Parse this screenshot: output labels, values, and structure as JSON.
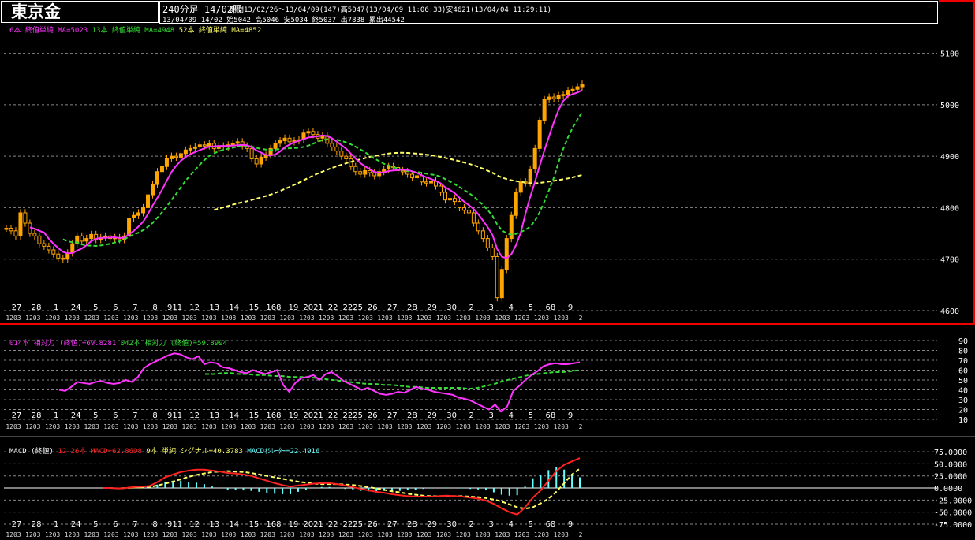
{
  "header": {
    "title": "東京金",
    "line1_main": "240分足 14/02限",
    "line1_rest": "期間13/02/26～13/04/09(147)高5047(13/04/09 11:06:33)安4621(13/04/04 11:29:11)",
    "line2": "13/04/09 14/02 始5042 高5046 安5034 終5037 出7838 累出44542"
  },
  "colors": {
    "magenta": "#ff33ff",
    "green": "#33dd33",
    "yellow": "#ffff66",
    "candle": "#ffa500",
    "cyan": "#66ffff",
    "red": "#ff2222",
    "grid": "#888888"
  },
  "legends": {
    "price": [
      {
        "text": "6本 終値単純 MA=5023",
        "color": "#ff33ff"
      },
      {
        "text": "13本 終値単純 MA=4948",
        "color": "#33dd33"
      },
      {
        "text": "52本 終値単純 MA=4852",
        "color": "#ffff66"
      }
    ],
    "rsi": [
      {
        "text": "014本 相対力 (終値)=69.8281",
        "color": "#ff33ff"
      },
      {
        "text": "042本 相対力 (終値)=59.8994",
        "color": "#33dd33"
      }
    ],
    "macd": [
      {
        "text": "MACD (終値)",
        "color": "#ffffff"
      },
      {
        "text": "12-26本 MACD=62.8698",
        "color": "#ff2222"
      },
      {
        "text": "9本 単純 シグナル=40.3783",
        "color": "#ffff66"
      },
      {
        "text": "MACDｵｼﾚｰﾀｰ=22.4916",
        "color": "#66ffff"
      }
    ]
  },
  "x_axis": {
    "day_labels": [
      "27",
      "28",
      "1",
      "24",
      "5",
      "6",
      "7",
      "8",
      "911",
      "12",
      "13",
      "14",
      "15",
      "168",
      "19",
      "2021",
      "22",
      "2225",
      "26",
      "27",
      "28",
      "29",
      "30",
      "2",
      "3",
      "4",
      "5",
      "68",
      "9"
    ],
    "month_codes": [
      "1203",
      "1203",
      "1203",
      "1203",
      "1203",
      "1203",
      "1203",
      "1203",
      "1203",
      "1203",
      "1203",
      "1203",
      "1203",
      "1203",
      "1203",
      "1203",
      "1203",
      "1203",
      "1203",
      "1203",
      "1203",
      "1203",
      "1203",
      "1203",
      "1203",
      "1203",
      "1203",
      "1203",
      "1203",
      "2"
    ]
  },
  "chart_data": [
    {
      "type": "candlestick",
      "name": "price",
      "ylim": [
        4600,
        5130
      ],
      "yticks": [
        "5100",
        "5000",
        "4900",
        "4800",
        "4700",
        "4600"
      ],
      "close": [
        4760,
        4755,
        4745,
        4790,
        4770,
        4750,
        4745,
        4730,
        4725,
        4718,
        4710,
        4702,
        4700,
        4712,
        4730,
        4745,
        4735,
        4740,
        4748,
        4738,
        4742,
        4745,
        4740,
        4742,
        4738,
        4745,
        4780,
        4785,
        4790,
        4800,
        4825,
        4845,
        4870,
        4880,
        4895,
        4900,
        4898,
        4905,
        4912,
        4915,
        4918,
        4922,
        4920,
        4925,
        4915,
        4920,
        4918,
        4922,
        4925,
        4928,
        4920,
        4915,
        4895,
        4885,
        4898,
        4902,
        4915,
        4925,
        4930,
        4935,
        4928,
        4930,
        4932,
        4945,
        4948,
        4942,
        4935,
        4940,
        4925,
        4918,
        4910,
        4900,
        4895,
        4880,
        4870,
        4865,
        4872,
        4868,
        4862,
        4870,
        4875,
        4880,
        4878,
        4872,
        4870,
        4865,
        4858,
        4862,
        4850,
        4848,
        4852,
        4842,
        4830,
        4815,
        4818,
        4812,
        4800,
        4795,
        4790,
        4770,
        4755,
        4740,
        4722,
        4705,
        4625,
        4680,
        4740,
        4785,
        4830,
        4850,
        4848,
        4875,
        4915,
        4970,
        5010,
        5015,
        5012,
        5018,
        5020,
        5028,
        5030,
        5035,
        5040
      ]
    },
    {
      "type": "line",
      "name": "RSI",
      "ylim": [
        10,
        90
      ],
      "yticks": [
        "90",
        "80",
        "70",
        "60",
        "50",
        "40",
        "30",
        "20",
        "10"
      ],
      "series": [
        {
          "name": "014本 相対力",
          "color": "#ff33ff",
          "values": [
            40,
            39,
            43,
            48,
            47,
            46,
            48,
            49,
            47,
            46,
            47,
            50,
            48,
            53,
            62,
            66,
            69,
            72,
            75,
            77,
            76,
            73,
            71,
            74,
            66,
            68,
            67,
            63,
            62,
            60,
            58,
            57,
            60,
            58,
            56,
            58,
            60,
            45,
            38,
            47,
            52,
            53,
            55,
            50,
            56,
            58,
            54,
            49,
            46,
            43,
            40,
            42,
            39,
            36,
            35,
            36,
            38,
            37,
            40,
            43,
            41,
            40,
            38,
            37,
            36,
            35,
            32,
            31,
            29,
            26,
            23,
            20,
            25,
            18,
            23,
            39,
            44,
            50,
            55,
            59,
            64,
            66,
            67,
            66,
            66,
            67,
            68
          ]
        },
        {
          "name": "042本 相対力",
          "color": "#33dd33",
          "values": [
            56,
            56,
            57,
            57,
            56,
            56,
            55,
            55,
            54,
            54,
            53,
            53,
            53,
            52,
            51,
            50,
            49,
            48,
            47,
            46,
            46,
            45,
            45,
            44,
            43,
            43,
            42,
            42,
            42,
            42,
            42,
            41,
            42,
            44,
            46,
            49,
            51,
            53,
            55,
            56,
            57,
            58,
            58,
            59,
            60
          ]
        }
      ]
    },
    {
      "type": "line",
      "name": "MACD",
      "ylim": [
        -80,
        80
      ],
      "yticks": [
        "75.0000",
        "50.0000",
        "25.0000",
        "0.0000",
        "-25.0000",
        "-50.0000",
        "-75.0000"
      ],
      "series": [
        {
          "name": "12-26本 MACD",
          "color": "#ff2222",
          "values": [
            0,
            0,
            -1,
            0,
            2,
            3,
            4,
            12,
            22,
            28,
            33,
            36,
            38,
            38,
            36,
            34,
            31,
            30,
            28,
            25,
            20,
            15,
            10,
            6,
            3,
            5,
            7,
            9,
            10,
            10,
            8,
            5,
            2,
            -2,
            -5,
            -8,
            -10,
            -13,
            -15,
            -17,
            -18,
            -18,
            -18,
            -17,
            -16,
            -17,
            -18,
            -20,
            -22,
            -26,
            -33,
            -42,
            -50,
            -55,
            -40,
            -20,
            -5,
            15,
            35,
            48,
            55,
            62
          ]
        },
        {
          "name": "9本 単純 シグナル",
          "color": "#ffff66",
          "values": [
            0,
            0,
            -1,
            0,
            1,
            1,
            2,
            5,
            9,
            13,
            18,
            23,
            27,
            30,
            33,
            34,
            35,
            34,
            33,
            31,
            28,
            25,
            22,
            19,
            16,
            13,
            11,
            9,
            8,
            8,
            8,
            7,
            6,
            4,
            2,
            -1,
            -4,
            -7,
            -9,
            -12,
            -14,
            -16,
            -17,
            -17,
            -17,
            -17,
            -17,
            -18,
            -19,
            -21,
            -24,
            -28,
            -34,
            -40,
            -43,
            -40,
            -32,
            -22,
            -8,
            10,
            28,
            40
          ]
        },
        {
          "name": "MACDｵｼﾚｰﾀｰ",
          "color": "#66ffff",
          "values": [
            0,
            0,
            0,
            0,
            1,
            2,
            2,
            7,
            13,
            15,
            15,
            13,
            11,
            8,
            3,
            0,
            -4,
            -4,
            -5,
            -6,
            -8,
            -10,
            -12,
            -13,
            -13,
            -8,
            -4,
            0,
            2,
            2,
            0,
            -2,
            -4,
            -6,
            -7,
            -7,
            -6,
            -6,
            -6,
            -5,
            -4,
            -2,
            -1,
            0,
            1,
            0,
            -1,
            -2,
            -3,
            -5,
            -9,
            -14,
            -16,
            -15,
            3,
            20,
            27,
            37,
            43,
            38,
            27,
            22
          ]
        }
      ]
    }
  ]
}
